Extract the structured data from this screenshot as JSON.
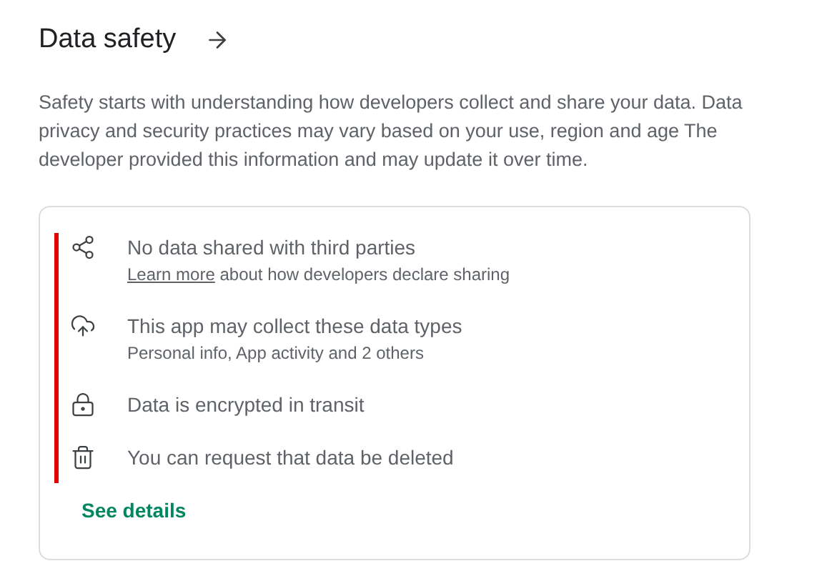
{
  "title": "Data safety",
  "description": "Safety starts with understanding how developers collect and share your data. Data privacy and security practices may vary based on your use, region and age The developer provided this information and may update it over time.",
  "items": [
    {
      "kind": "share",
      "title": "No data shared with third parties",
      "link": "Learn more",
      "subtitle": "about how developers declare sharing"
    },
    {
      "kind": "cloud",
      "title": "This app may collect these data types",
      "subtitle": "Personal info, App activity and 2 others"
    },
    {
      "kind": "lock",
      "title": "Data is encrypted in transit"
    },
    {
      "kind": "trash",
      "title": "You can request that data be deleted"
    }
  ],
  "details_link": "See details"
}
